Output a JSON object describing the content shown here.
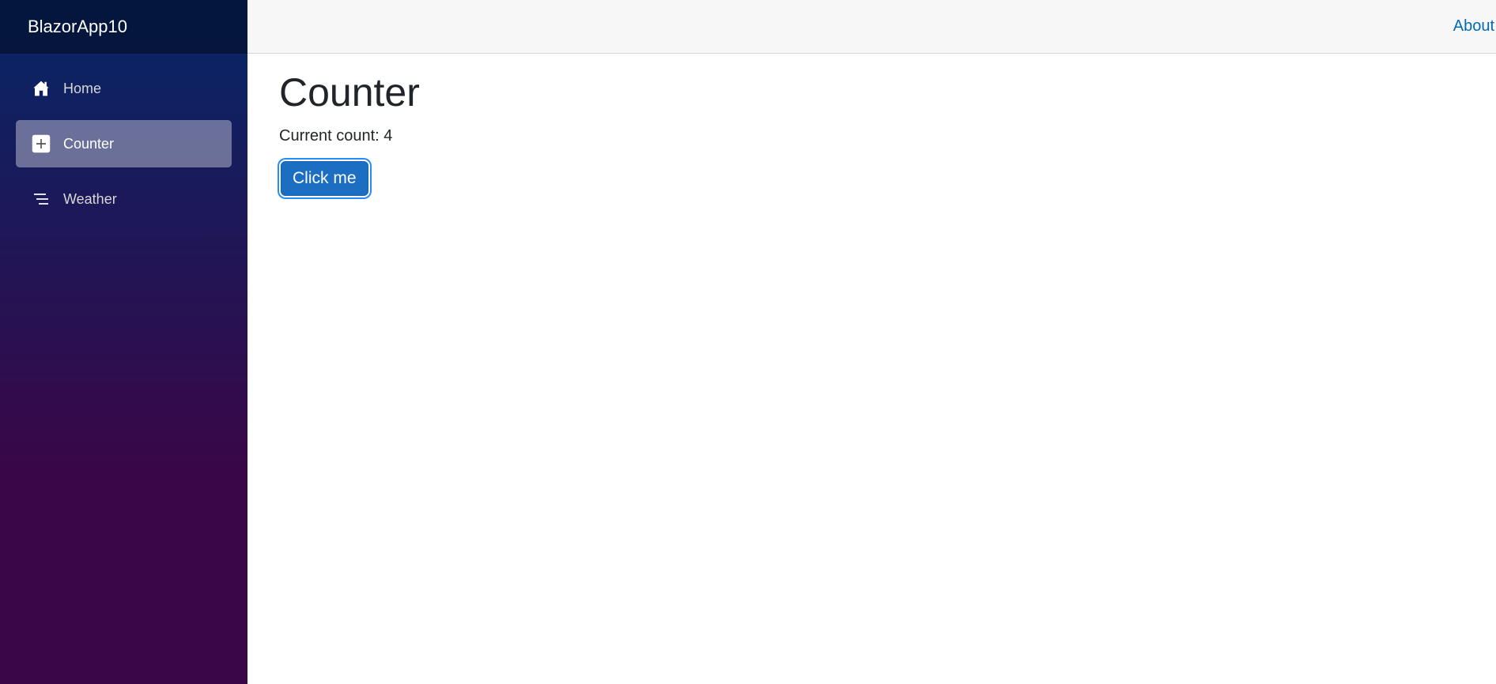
{
  "sidebar": {
    "brand": "BlazorApp10",
    "items": [
      {
        "label": "Home",
        "icon": "house-icon",
        "active": false
      },
      {
        "label": "Counter",
        "icon": "plus-square-icon",
        "active": true
      },
      {
        "label": "Weather",
        "icon": "list-icon",
        "active": false
      }
    ]
  },
  "header": {
    "about_label": "About"
  },
  "main": {
    "title": "Counter",
    "count_text": "Current count: 4",
    "button_label": "Click me"
  },
  "colors": {
    "sidebar_top": "#052767",
    "sidebar_bottom": "#3a0647",
    "primary": "#1b6ec2",
    "link": "#006bb7"
  }
}
